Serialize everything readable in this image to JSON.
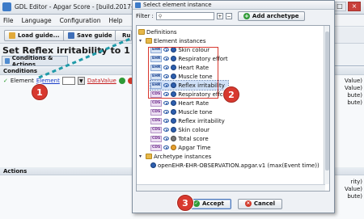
{
  "editor": {
    "title": "GDL Editor - Apgar Score - [build.2017-04-04_13-1",
    "menu": [
      "File",
      "Language",
      "Configuration",
      "Help"
    ],
    "toolbar": {
      "load": "Load guide...",
      "save": "Save guide",
      "run": "Ru"
    },
    "heading": "Set Reflex irritability to 1",
    "tab": "Conditions & Actions",
    "conditions_label": "Conditions",
    "actions_label": "Actions",
    "condition": {
      "prefix": "Element",
      "element_link": "Element",
      "value_link": "DataValue"
    },
    "right_labels": [
      "Value)",
      "Value)",
      "bute)",
      "bute)",
      "rity)",
      "Value)",
      "bute)"
    ]
  },
  "dialog": {
    "title": "Select element instance",
    "filter_label": "Filter :",
    "filter_value": "",
    "add_archetype": "Add archetype",
    "tree": {
      "root": "Definitions",
      "element_instances": "Element instances",
      "ehr_items": [
        "Skin colour",
        "Respiratory effort",
        "Heart Rate",
        "Muscle tone",
        "Reflex irritability"
      ],
      "cds_items": [
        "Respiratory effort",
        "Heart Rate",
        "Muscle tone",
        "Reflex irritability",
        "Skin colour",
        "Total score",
        "Apgar Time"
      ],
      "archetype_instances": "Archetype instances",
      "archetype_item": "openEHR-EHR-OBSERVATION.apgar.v1 (max(Event time))"
    },
    "badges": {
      "ehr": "EHR",
      "cds": "CDS"
    },
    "selected_item": "Reflex irritability",
    "accept": "Accept",
    "cancel": "Cancel"
  },
  "callouts": [
    "1",
    "2",
    "3"
  ],
  "colors": {
    "callout": "#d8392f",
    "accent": "#3d7bc8",
    "link": "#1a3cc8",
    "datavalue": "#c41e1e"
  }
}
